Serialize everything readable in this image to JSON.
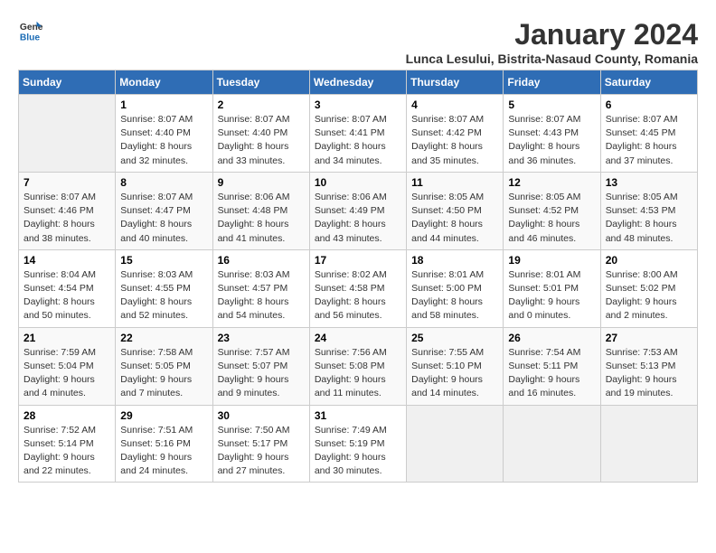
{
  "logo": {
    "text_general": "General",
    "text_blue": "Blue"
  },
  "title": "January 2024",
  "subtitle": "Lunca Lesului, Bistrita-Nasaud County, Romania",
  "days_of_week": [
    "Sunday",
    "Monday",
    "Tuesday",
    "Wednesday",
    "Thursday",
    "Friday",
    "Saturday"
  ],
  "weeks": [
    [
      {
        "day": "",
        "info": ""
      },
      {
        "day": "1",
        "info": "Sunrise: 8:07 AM\nSunset: 4:40 PM\nDaylight: 8 hours\nand 32 minutes."
      },
      {
        "day": "2",
        "info": "Sunrise: 8:07 AM\nSunset: 4:40 PM\nDaylight: 8 hours\nand 33 minutes."
      },
      {
        "day": "3",
        "info": "Sunrise: 8:07 AM\nSunset: 4:41 PM\nDaylight: 8 hours\nand 34 minutes."
      },
      {
        "day": "4",
        "info": "Sunrise: 8:07 AM\nSunset: 4:42 PM\nDaylight: 8 hours\nand 35 minutes."
      },
      {
        "day": "5",
        "info": "Sunrise: 8:07 AM\nSunset: 4:43 PM\nDaylight: 8 hours\nand 36 minutes."
      },
      {
        "day": "6",
        "info": "Sunrise: 8:07 AM\nSunset: 4:45 PM\nDaylight: 8 hours\nand 37 minutes."
      }
    ],
    [
      {
        "day": "7",
        "info": "Sunrise: 8:07 AM\nSunset: 4:46 PM\nDaylight: 8 hours\nand 38 minutes."
      },
      {
        "day": "8",
        "info": "Sunrise: 8:07 AM\nSunset: 4:47 PM\nDaylight: 8 hours\nand 40 minutes."
      },
      {
        "day": "9",
        "info": "Sunrise: 8:06 AM\nSunset: 4:48 PM\nDaylight: 8 hours\nand 41 minutes."
      },
      {
        "day": "10",
        "info": "Sunrise: 8:06 AM\nSunset: 4:49 PM\nDaylight: 8 hours\nand 43 minutes."
      },
      {
        "day": "11",
        "info": "Sunrise: 8:05 AM\nSunset: 4:50 PM\nDaylight: 8 hours\nand 44 minutes."
      },
      {
        "day": "12",
        "info": "Sunrise: 8:05 AM\nSunset: 4:52 PM\nDaylight: 8 hours\nand 46 minutes."
      },
      {
        "day": "13",
        "info": "Sunrise: 8:05 AM\nSunset: 4:53 PM\nDaylight: 8 hours\nand 48 minutes."
      }
    ],
    [
      {
        "day": "14",
        "info": "Sunrise: 8:04 AM\nSunset: 4:54 PM\nDaylight: 8 hours\nand 50 minutes."
      },
      {
        "day": "15",
        "info": "Sunrise: 8:03 AM\nSunset: 4:55 PM\nDaylight: 8 hours\nand 52 minutes."
      },
      {
        "day": "16",
        "info": "Sunrise: 8:03 AM\nSunset: 4:57 PM\nDaylight: 8 hours\nand 54 minutes."
      },
      {
        "day": "17",
        "info": "Sunrise: 8:02 AM\nSunset: 4:58 PM\nDaylight: 8 hours\nand 56 minutes."
      },
      {
        "day": "18",
        "info": "Sunrise: 8:01 AM\nSunset: 5:00 PM\nDaylight: 8 hours\nand 58 minutes."
      },
      {
        "day": "19",
        "info": "Sunrise: 8:01 AM\nSunset: 5:01 PM\nDaylight: 9 hours\nand 0 minutes."
      },
      {
        "day": "20",
        "info": "Sunrise: 8:00 AM\nSunset: 5:02 PM\nDaylight: 9 hours\nand 2 minutes."
      }
    ],
    [
      {
        "day": "21",
        "info": "Sunrise: 7:59 AM\nSunset: 5:04 PM\nDaylight: 9 hours\nand 4 minutes."
      },
      {
        "day": "22",
        "info": "Sunrise: 7:58 AM\nSunset: 5:05 PM\nDaylight: 9 hours\nand 7 minutes."
      },
      {
        "day": "23",
        "info": "Sunrise: 7:57 AM\nSunset: 5:07 PM\nDaylight: 9 hours\nand 9 minutes."
      },
      {
        "day": "24",
        "info": "Sunrise: 7:56 AM\nSunset: 5:08 PM\nDaylight: 9 hours\nand 11 minutes."
      },
      {
        "day": "25",
        "info": "Sunrise: 7:55 AM\nSunset: 5:10 PM\nDaylight: 9 hours\nand 14 minutes."
      },
      {
        "day": "26",
        "info": "Sunrise: 7:54 AM\nSunset: 5:11 PM\nDaylight: 9 hours\nand 16 minutes."
      },
      {
        "day": "27",
        "info": "Sunrise: 7:53 AM\nSunset: 5:13 PM\nDaylight: 9 hours\nand 19 minutes."
      }
    ],
    [
      {
        "day": "28",
        "info": "Sunrise: 7:52 AM\nSunset: 5:14 PM\nDaylight: 9 hours\nand 22 minutes."
      },
      {
        "day": "29",
        "info": "Sunrise: 7:51 AM\nSunset: 5:16 PM\nDaylight: 9 hours\nand 24 minutes."
      },
      {
        "day": "30",
        "info": "Sunrise: 7:50 AM\nSunset: 5:17 PM\nDaylight: 9 hours\nand 27 minutes."
      },
      {
        "day": "31",
        "info": "Sunrise: 7:49 AM\nSunset: 5:19 PM\nDaylight: 9 hours\nand 30 minutes."
      },
      {
        "day": "",
        "info": ""
      },
      {
        "day": "",
        "info": ""
      },
      {
        "day": "",
        "info": ""
      }
    ]
  ]
}
